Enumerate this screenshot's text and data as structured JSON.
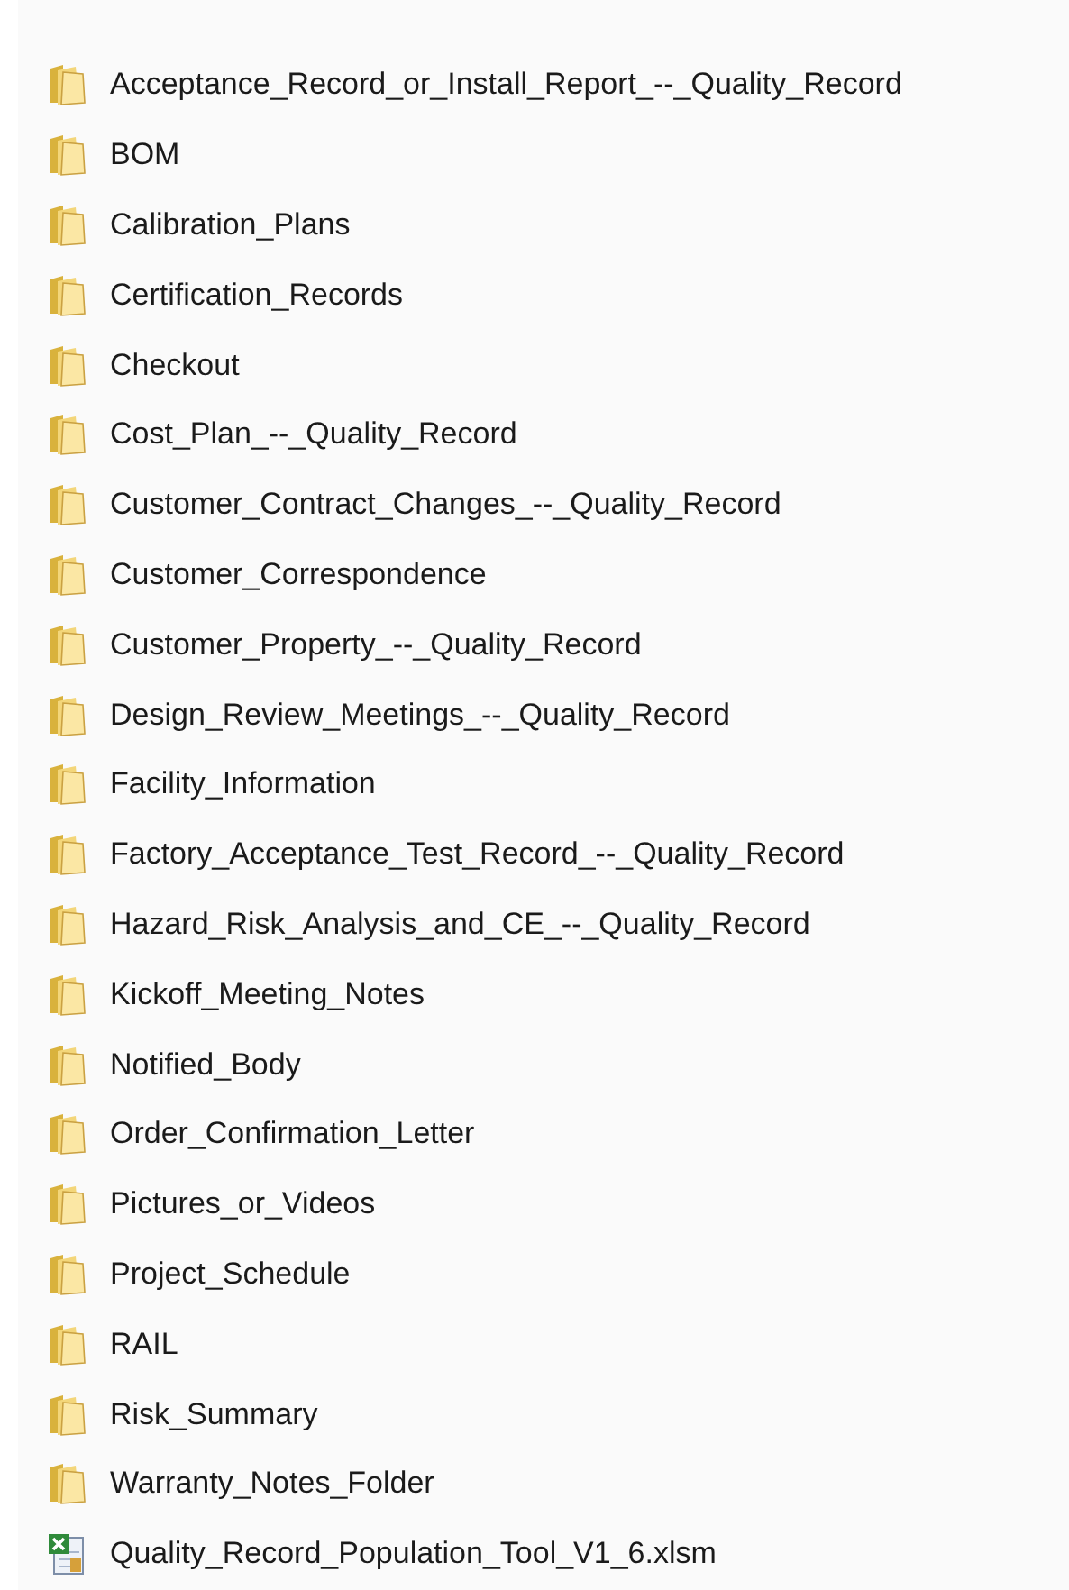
{
  "items": [
    {
      "name": "Acceptance_Record_or_Install_Report_--_Quality_Record",
      "kind": "folder"
    },
    {
      "name": "BOM",
      "kind": "folder"
    },
    {
      "name": "Calibration_Plans",
      "kind": "folder"
    },
    {
      "name": "Certification_Records",
      "kind": "folder"
    },
    {
      "name": "Checkout",
      "kind": "folder"
    },
    {
      "name": "Cost_Plan_--_Quality_Record",
      "kind": "folder"
    },
    {
      "name": "Customer_Contract_Changes_--_Quality_Record",
      "kind": "folder"
    },
    {
      "name": "Customer_Correspondence",
      "kind": "folder"
    },
    {
      "name": "Customer_Property_--_Quality_Record",
      "kind": "folder"
    },
    {
      "name": "Design_Review_Meetings_--_Quality_Record",
      "kind": "folder"
    },
    {
      "name": "Facility_Information",
      "kind": "folder"
    },
    {
      "name": "Factory_Acceptance_Test_Record_--_Quality_Record",
      "kind": "folder"
    },
    {
      "name": "Hazard_Risk_Analysis_and_CE_--_Quality_Record",
      "kind": "folder"
    },
    {
      "name": "Kickoff_Meeting_Notes",
      "kind": "folder"
    },
    {
      "name": "Notified_Body",
      "kind": "folder"
    },
    {
      "name": "Order_Confirmation_Letter",
      "kind": "folder"
    },
    {
      "name": "Pictures_or_Videos",
      "kind": "folder"
    },
    {
      "name": "Project_Schedule",
      "kind": "folder"
    },
    {
      "name": "RAIL",
      "kind": "folder"
    },
    {
      "name": "Risk_Summary",
      "kind": "folder"
    },
    {
      "name": "Warranty_Notes_Folder",
      "kind": "folder"
    },
    {
      "name": "Quality_Record_Population_Tool_V1_6.xlsm",
      "kind": "spreadsheet"
    }
  ]
}
